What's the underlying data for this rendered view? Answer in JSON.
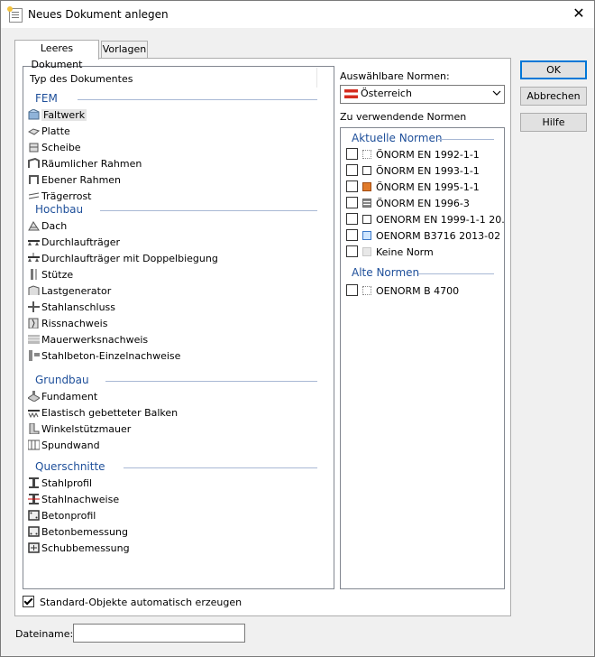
{
  "window": {
    "title": "Neues Dokument anlegen",
    "close_glyph": "✕"
  },
  "tabs": [
    {
      "label": "Leeres Dokument"
    },
    {
      "label": "Vorlagen"
    }
  ],
  "doc_list": {
    "header": "Typ des Dokumentes",
    "groups": [
      {
        "label": "FEM",
        "items": [
          {
            "label": "Faltwerk",
            "icon": "faltwerk-icon",
            "selected": true
          },
          {
            "label": "Platte",
            "icon": "platte-icon"
          },
          {
            "label": "Scheibe",
            "icon": "scheibe-icon"
          },
          {
            "label": "Räumlicher Rahmen",
            "icon": "raeumlicher-rahmen-icon"
          },
          {
            "label": "Ebener Rahmen",
            "icon": "ebener-rahmen-icon"
          },
          {
            "label": "Trägerrost",
            "icon": "traegerrost-icon"
          }
        ]
      },
      {
        "label": "Hochbau",
        "items": [
          {
            "label": "Dach",
            "icon": "dach-icon"
          },
          {
            "label": "Durchlaufträger",
            "icon": "durchlauftraeger-icon"
          },
          {
            "label": "Durchlaufträger mit Doppelbiegung",
            "icon": "doppelbiegung-icon"
          },
          {
            "label": "Stütze",
            "icon": "stuetze-icon"
          },
          {
            "label": "Lastgenerator",
            "icon": "lastgenerator-icon"
          },
          {
            "label": "Stahlanschluss",
            "icon": "stahlanschluss-icon"
          },
          {
            "label": "Rissnachweis",
            "icon": "rissnachweis-icon"
          },
          {
            "label": "Mauerwerksnachweis",
            "icon": "mauerwerk-icon"
          },
          {
            "label": "Stahlbeton-Einzelnachweise",
            "icon": "stahlbeton-icon"
          }
        ]
      },
      {
        "label": "Grundbau",
        "items": [
          {
            "label": "Fundament",
            "icon": "fundament-icon"
          },
          {
            "label": "Elastisch gebetteter Balken",
            "icon": "balken-icon"
          },
          {
            "label": "Winkelstützmauer",
            "icon": "winkelstuetzmauer-icon"
          },
          {
            "label": "Spundwand",
            "icon": "spundwand-icon"
          }
        ]
      },
      {
        "label": "Querschnitte",
        "items": [
          {
            "label": "Stahlprofil",
            "icon": "stahlprofil-icon"
          },
          {
            "label": "Stahlnachweise",
            "icon": "stahlnachweise-icon"
          },
          {
            "label": "Betonprofil",
            "icon": "betonprofil-icon"
          },
          {
            "label": "Betonbemessung",
            "icon": "betonbemessung-icon"
          },
          {
            "label": "Schubbemessung",
            "icon": "schubbemessung-icon"
          }
        ]
      }
    ]
  },
  "norms": {
    "selectable_label": "Auswählbare Normen:",
    "selected_country": "Österreich",
    "use_label": "Zu verwendende Normen",
    "current_group": "Aktuelle Normen",
    "current": [
      {
        "label": "ÖNORM EN 1992-1-1",
        "icon": "concrete-norm-icon",
        "checked": false
      },
      {
        "label": "ÖNORM EN 1993-1-1",
        "icon": "steel-norm-icon",
        "checked": false
      },
      {
        "label": "ÖNORM EN 1995-1-1",
        "icon": "timber-norm-icon",
        "checked": false
      },
      {
        "label": "ÖNORM EN 1996-3",
        "icon": "masonry-norm-icon",
        "checked": false
      },
      {
        "label": "OENORM EN 1999-1-1 20...",
        "icon": "aluminium-norm-icon",
        "checked": false
      },
      {
        "label": "OENORM B3716 2013-02",
        "icon": "glass-norm-icon",
        "checked": false
      },
      {
        "label": "Keine Norm",
        "icon": "no-norm-icon",
        "checked": false
      }
    ],
    "old_group": "Alte Normen",
    "old": [
      {
        "label": "OENORM B 4700",
        "icon": "concrete-norm-icon",
        "checked": false
      }
    ]
  },
  "auto_objects": {
    "label": "Standard-Objekte automatisch erzeugen",
    "checked": true
  },
  "filename": {
    "label": "Dateiname:",
    "value": ""
  },
  "buttons": {
    "ok": "OK",
    "cancel": "Abbrechen",
    "help": "Hilfe"
  },
  "colors": {
    "group_text": "#1e4f9a",
    "default_button_border": "#0078d7"
  }
}
